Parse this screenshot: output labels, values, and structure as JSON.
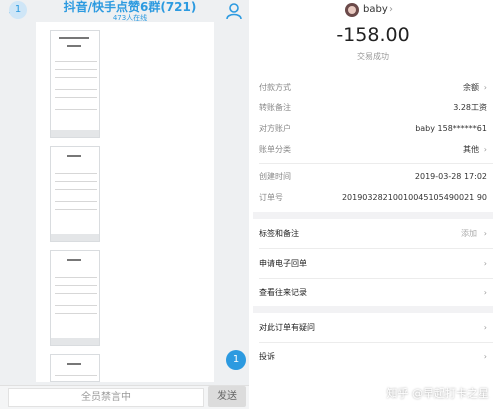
{
  "chat": {
    "back_badge": "1",
    "title": "抖音/快手点赞6群(721)",
    "online": "473人在线",
    "float_badge": "1",
    "mute_text": "全员禁言中",
    "send_label": "发送"
  },
  "detail": {
    "user_name": "baby",
    "amount": "-158.00",
    "status": "交易成功",
    "rows": [
      {
        "label": "付款方式",
        "value": "余额"
      },
      {
        "label": "转账备注",
        "value": "3.28工资"
      },
      {
        "label": "对方账户",
        "value": "baby 158******61"
      },
      {
        "label": "账单分类",
        "value": "其他"
      },
      {
        "label": "创建时间",
        "value": "2019-03-28 17:02"
      },
      {
        "label": "订单号",
        "value": "20190328210010045105490021 90"
      }
    ],
    "actions": [
      {
        "label": "标签和备注",
        "value": "添加"
      },
      {
        "label": "申请电子回单"
      },
      {
        "label": "查看往来记录"
      },
      {
        "label": "对此订单有疑问"
      },
      {
        "label": "投诉"
      }
    ]
  },
  "watermark": "知乎 @早起打卡之星",
  "colors": {
    "accent": "#2c9ae0",
    "panel_bg": "#eef0f2"
  },
  "icons": {
    "person": "person-icon",
    "chevron": "chevron-right-icon",
    "back": "back-arrow-icon"
  }
}
